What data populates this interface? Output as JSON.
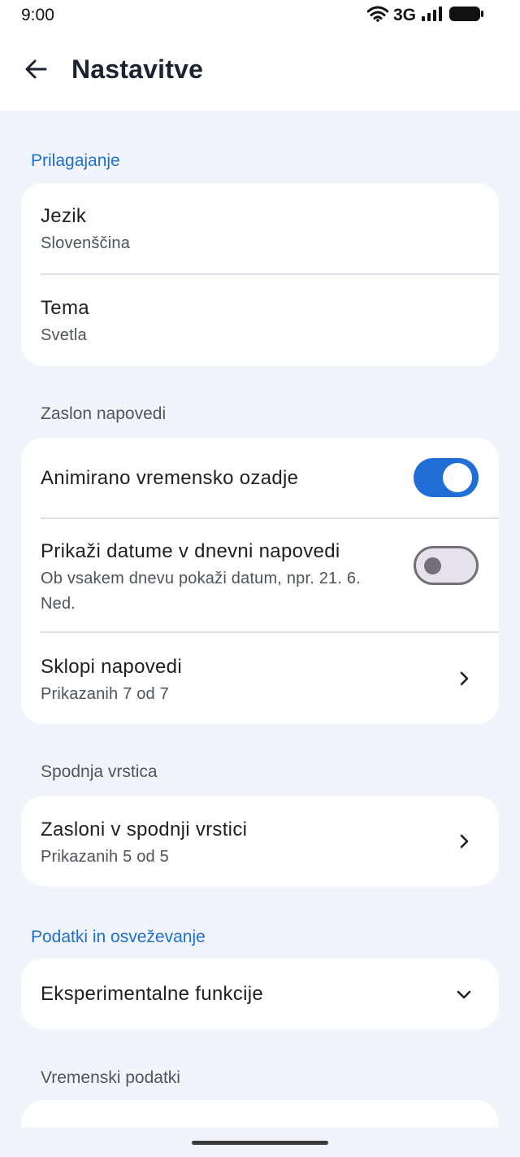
{
  "status_bar": {
    "time": "9:00",
    "network": "3G",
    "icons": [
      "wifi-icon",
      "signal-icon",
      "battery-icon"
    ]
  },
  "app_bar": {
    "title": "Nastavitve",
    "back_icon": "arrow-back-icon"
  },
  "sections": {
    "prilagajanje": {
      "header": "Prilagajanje",
      "items": [
        {
          "title": "Jezik",
          "subtitle": "Slovenščina"
        },
        {
          "title": "Tema",
          "subtitle": "Svetla"
        }
      ]
    },
    "zaslon_napovedi": {
      "header": "Zaslon napovedi",
      "items": [
        {
          "title": "Animirano vremensko ozadje",
          "toggle": true
        },
        {
          "title": "Prikaži datume v dnevni napovedi",
          "subtitle": "Ob vsakem dnevu pokaži datum, npr. 21. 6. Ned.",
          "toggle": false
        },
        {
          "title": "Sklopi napovedi",
          "subtitle": "Prikazanih 7 od 7",
          "icon": "chevron-right-icon"
        }
      ]
    },
    "spodnja_vrstica": {
      "header": "Spodnja vrstica",
      "items": [
        {
          "title": "Zasloni v spodnji vrstici",
          "subtitle": "Prikazanih 5 od 5",
          "icon": "chevron-right-icon"
        }
      ]
    },
    "podatki": {
      "header": "Podatki in osveževanje",
      "items": [
        {
          "title": "Eksperimentalne funkcije",
          "icon": "chevron-down-icon"
        }
      ]
    },
    "vremenski_podatki": {
      "header": "Vremenski podatki"
    }
  },
  "colors": {
    "accent": "#1d6fd1",
    "background": "#f1f5fb",
    "card": "#ffffff",
    "toggle_on": "#1f6fd6",
    "toggle_off_track": "#e6e2ea"
  }
}
